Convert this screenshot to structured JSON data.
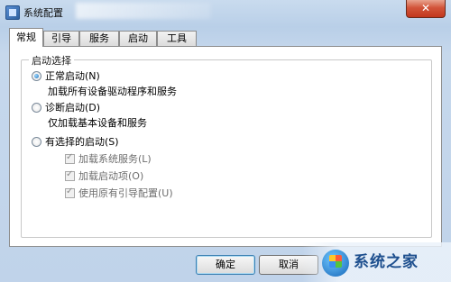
{
  "window": {
    "title": "系统配置",
    "close_symbol": "✕"
  },
  "tabs": [
    {
      "label": "常规",
      "active": true
    },
    {
      "label": "引导",
      "active": false
    },
    {
      "label": "服务",
      "active": false
    },
    {
      "label": "启动",
      "active": false
    },
    {
      "label": "工具",
      "active": false
    }
  ],
  "startup_group": {
    "legend": "启动选择",
    "normal": {
      "label": "正常启动(N)",
      "desc": "加载所有设备驱动程序和服务",
      "selected": true
    },
    "diagnostic": {
      "label": "诊断启动(D)",
      "desc": "仅加载基本设备和服务",
      "selected": false
    },
    "selective": {
      "label": "有选择的启动(S)",
      "selected": false,
      "options": [
        {
          "label": "加载系统服务(L)",
          "checked": true
        },
        {
          "label": "加载启动项(O)",
          "checked": true
        },
        {
          "label": "使用原有引导配置(U)",
          "checked": true
        }
      ]
    }
  },
  "buttons": {
    "ok": "确定",
    "cancel": "取消"
  },
  "watermark": {
    "text": "系统之家"
  }
}
